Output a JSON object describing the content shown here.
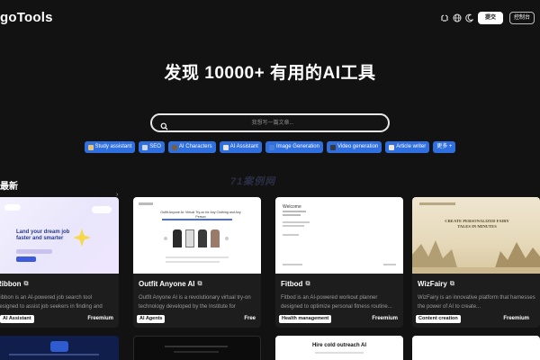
{
  "header": {
    "logo": "goTools",
    "icons": [
      "github-icon",
      "globe-icon",
      "moon-icon"
    ],
    "submit_label": "提交",
    "console_label": "控制台"
  },
  "hero": {
    "title": "发现 10000+ 有用的AI工具"
  },
  "search": {
    "placeholder": "我想写一篇文章..."
  },
  "chips": [
    {
      "label": "Study assistant",
      "icon_color": "#e8c27a"
    },
    {
      "label": "SEO",
      "icon_color": "#cfd8ea"
    },
    {
      "label": "AI Characters",
      "icon_color": "#7a5e3e"
    },
    {
      "label": "AI Assistant",
      "icon_color": "#e6e6f2"
    },
    {
      "label": "Image Generation",
      "icon_color": "#4a7fd8"
    },
    {
      "label": "Video generation",
      "icon_color": "#3a3a3a"
    },
    {
      "label": "Article writer",
      "icon_color": "#f4e9d6"
    },
    {
      "label": "更多 +",
      "icon_color": ""
    }
  ],
  "watermark": "71案例网",
  "section": {
    "title": "最新"
  },
  "cards": [
    {
      "name": "Ribbon",
      "desc": "Ribbon is an AI-powered job search tool designed to assist job seekers in finding and",
      "tag": "AI Assistant",
      "price": "Freemium",
      "thumb_text": "Land your dream job faster and smarter"
    },
    {
      "name": "Outfit Anyone AI",
      "desc": "Outfit Anyone AI is a revolutionary virtual try-on technology developed by the Institute for",
      "tag": "AI Agents",
      "price": "Free",
      "thumb_text": "Outfit Anyone AI: Virtual Try-on for Any Clothing and Any Person"
    },
    {
      "name": "Fitbod",
      "desc": "Fitbod is an AI-powered workout planner designed to optimize personal fitness routine...",
      "tag": "Health management",
      "price": "Freemium",
      "thumb_text": "Welcome"
    },
    {
      "name": "WizFairy",
      "desc": "WizFairy is an innovative platform that harnesses the power of AI to create...",
      "tag": "Content creation",
      "price": "Freemium",
      "thumb_text": "CREATE PERSONALIZED FAIRY TALES IN MINUTES"
    }
  ],
  "second_row": {
    "card3_text": "Hire cold outreach AI"
  },
  "colors": {
    "background": "#121212",
    "card_bg": "#1d1d1d",
    "chip_blue": "#2f6fe0"
  }
}
